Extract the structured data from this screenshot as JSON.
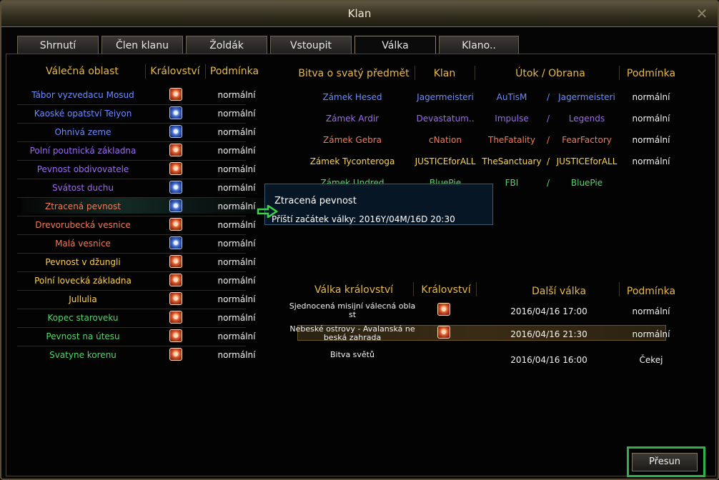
{
  "window": {
    "title": "Klan"
  },
  "tabs": [
    {
      "label": "Shrnutí"
    },
    {
      "label": "Člen klanu"
    },
    {
      "label": "Žoldák"
    },
    {
      "label": "Vstoupit"
    },
    {
      "label": "Válka",
      "active": true
    },
    {
      "label": "Klano.."
    }
  ],
  "war_areas": {
    "headers": {
      "area": "Válečná oblast",
      "kingdom": "Království",
      "condition": "Podmínka"
    },
    "rows": [
      {
        "name": "Tábor vyzvedacu Mosud",
        "color": "#6d8cff",
        "emblem": "lion-emblem-icon",
        "condition": "normální"
      },
      {
        "name": "Kaoské opatství Teiyon",
        "color": "#6d8cff",
        "emblem": "yin-yang-emblem-icon",
        "condition": "normální"
      },
      {
        "name": "Ohnivá zeme",
        "color": "#6d8cff",
        "emblem": "yin-yang-emblem-icon",
        "condition": "normální"
      },
      {
        "name": "Polní poutnická základna",
        "color": "#9b6bf0",
        "emblem": "lion-emblem-icon",
        "condition": "normální"
      },
      {
        "name": "Pevnost obdivovatele",
        "color": "#9b6bf0",
        "emblem": "lion-emblem-icon",
        "condition": "normální"
      },
      {
        "name": "Svátost duchu",
        "color": "#9b6bf0",
        "emblem": "yin-yang-emblem-icon",
        "condition": "normální"
      },
      {
        "name": "Ztracená pevnost",
        "color": "#f07b58",
        "emblem": "yin-yang-emblem-icon",
        "condition": "normální"
      },
      {
        "name": "Drevorubecká vesnice",
        "color": "#f07b58",
        "emblem": "lion-emblem-icon",
        "condition": "normální"
      },
      {
        "name": "Malá vesnice",
        "color": "#f07b58",
        "emblem": "yin-yang-emblem-icon",
        "condition": "normální"
      },
      {
        "name": "Pevnost v džungli",
        "color": "#ffd24a",
        "emblem": "lion-emblem-icon",
        "condition": "normální"
      },
      {
        "name": "Polní lovecká základna",
        "color": "#ffd24a",
        "emblem": "lion-emblem-icon",
        "condition": "normální"
      },
      {
        "name": "Jullulia",
        "color": "#ffd24a",
        "emblem": "lion-emblem-icon",
        "condition": "normální"
      },
      {
        "name": "Kopec staroveku",
        "color": "#55d76a",
        "emblem": "lion-emblem-icon",
        "condition": "normální"
      },
      {
        "name": "Pevnost na útesu",
        "color": "#55d76a",
        "emblem": "lion-emblem-icon",
        "condition": "normální"
      },
      {
        "name": "Svatyne korenu",
        "color": "#55d76a",
        "emblem": "lion-emblem-icon",
        "condition": "normální"
      }
    ]
  },
  "holy_battles": {
    "headers": {
      "battle": "Bitva o svatý předmět",
      "clan": "Klan",
      "attack_defense": "Útok / Obrana",
      "condition": "Podmínka"
    },
    "rows": [
      {
        "castle": "Zámek Hesed",
        "clan": "Jagermeisteri",
        "attacker": "AuTisM",
        "slash": "/",
        "defender": "Jagermeisteri",
        "condition": "normální",
        "color": "#6d8cff"
      },
      {
        "castle": "Zámek Ardir",
        "clan": "Devastatum..",
        "attacker": "Impulse",
        "slash": "/",
        "defender": "Legends",
        "condition": "normální",
        "color": "#9b6bf0"
      },
      {
        "castle": "Zámek Gebra",
        "clan": "cNation",
        "attacker": "TheFatality",
        "slash": "/",
        "defender": "FearFactory",
        "condition": "normální",
        "color": "#f07b58"
      },
      {
        "castle": "Zámek Tyconteroga",
        "clan": "JUSTICEforALL",
        "attacker": "TheSanctuary",
        "slash": "/",
        "defender": "JUSTICEforALL",
        "condition": "normální",
        "color": "#ffd24a"
      },
      {
        "castle": "Zámek Undred",
        "clan": "BluePie",
        "attacker": "FBI",
        "slash": "/",
        "defender": "BluePie",
        "condition": "",
        "color": "#55d76a"
      }
    ]
  },
  "tooltip": {
    "title": "Ztracená pevnost",
    "next_war": "Příští začátek války: 2016Y/04M/16D 20:30"
  },
  "kingdom_wars": {
    "headers": {
      "war": "Válka království",
      "kingdom": "Království",
      "next": "Další válka",
      "condition": "Podmínka"
    },
    "rows": [
      {
        "line1": "Sjednocená misijní válecná obla",
        "line2": "st",
        "emblem": "lion-emblem-icon",
        "date": "2016/04/16 17:00",
        "condition": "normální"
      },
      {
        "line1": "Nebeské ostrovy - Avalanská ne",
        "line2": "beská zahrada",
        "emblem": "lion-emblem-icon",
        "date": "2016/04/16 21:30",
        "condition": "normální"
      },
      {
        "line1": "Bitva světů",
        "line2": "",
        "emblem": "",
        "date": "2016/04/16 16:00",
        "condition": "Čekej"
      }
    ]
  },
  "buttons": {
    "move": "Přesun"
  }
}
